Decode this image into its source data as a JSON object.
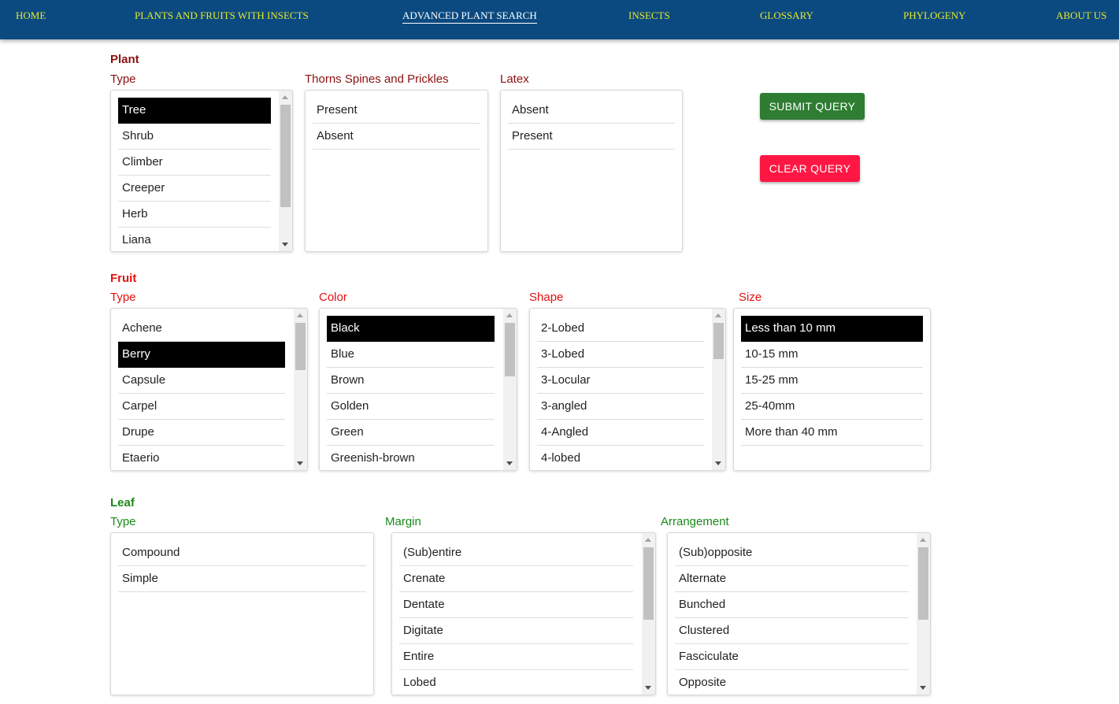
{
  "nav": {
    "items": [
      "HOME",
      "PLANTS AND FRUITS WITH INSECTS",
      "ADVANCED PLANT SEARCH",
      "INSECTS",
      "GLOSSARY",
      "PHYLOGENY",
      "ABOUT US"
    ],
    "active": "ADVANCED PLANT SEARCH"
  },
  "colors": {
    "nav_bg": "#0b4a80",
    "plant": "#8b1010",
    "fruit": "#e61010",
    "leaf": "#1a8a1a",
    "submit": "#2e7d32",
    "clear": "#ff1744"
  },
  "plant": {
    "heading": "Plant",
    "type_label": "Type",
    "thorns_label": "Thorns Spines and Prickles",
    "latex_label": "Latex",
    "type_options": [
      "Tree",
      "Shrub",
      "Climber",
      "Creeper",
      "Herb",
      "Liana"
    ],
    "type_selected": "Tree",
    "thorns_options": [
      "Present",
      "Absent"
    ],
    "latex_options": [
      "Absent",
      "Present"
    ]
  },
  "buttons": {
    "submit": "SUBMIT QUERY",
    "clear": "CLEAR QUERY"
  },
  "fruit": {
    "heading": "Fruit",
    "type_label": "Type",
    "color_label": "Color",
    "shape_label": "Shape",
    "size_label": "Size",
    "type_options": [
      "Achene",
      "Berry",
      "Capsule",
      "Carpel",
      "Drupe",
      "Etaerio"
    ],
    "type_selected": "Berry",
    "color_options": [
      "Black",
      "Blue",
      "Brown",
      "Golden",
      "Green",
      "Greenish-brown"
    ],
    "color_selected": "Black",
    "shape_options": [
      "2-Lobed",
      "3-Lobed",
      "3-Locular",
      "3-angled",
      "4-Angled",
      "4-lobed"
    ],
    "size_options": [
      "Less than 10 mm",
      "10-15 mm",
      "15-25 mm",
      "25-40mm",
      "More than 40 mm"
    ],
    "size_selected": "Less than 10 mm"
  },
  "leaf": {
    "heading": "Leaf",
    "type_label": "Type",
    "margin_label": "Margin",
    "arrangement_label": "Arrangement",
    "type_options": [
      "Compound",
      "Simple"
    ],
    "margin_options": [
      "(Sub)entire",
      "Crenate",
      "Dentate",
      "Digitate",
      "Entire",
      "Lobed"
    ],
    "arrangement_options": [
      "(Sub)opposite",
      "Alternate",
      "Bunched",
      "Clustered",
      "Fasciculate",
      "Opposite"
    ]
  }
}
